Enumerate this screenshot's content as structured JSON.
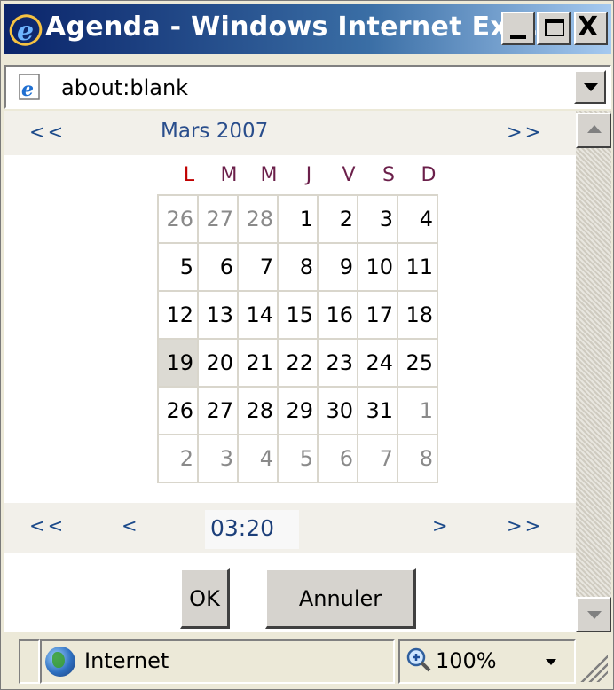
{
  "window": {
    "title": "Agenda - Windows Internet Ex...",
    "minimize_icon": "minimize-icon",
    "maximize_icon": "maximize-icon",
    "close_icon": "close-icon",
    "close_glyph": "X"
  },
  "address": {
    "url": "about:blank",
    "page_icon": "ie-page-icon"
  },
  "calendar": {
    "prev_month": "<<",
    "next_month": ">>",
    "month_label": "Mars 2007",
    "weekdays": [
      "L",
      "M",
      "M",
      "J",
      "V",
      "S",
      "D"
    ],
    "weeks": [
      [
        "26",
        "27",
        "28",
        "1",
        "2",
        "3",
        "4"
      ],
      [
        "5",
        "6",
        "7",
        "8",
        "9",
        "10",
        "11"
      ],
      [
        "12",
        "13",
        "14",
        "15",
        "16",
        "17",
        "18"
      ],
      [
        "19",
        "20",
        "21",
        "22",
        "23",
        "24",
        "25"
      ],
      [
        "26",
        "27",
        "28",
        "29",
        "30",
        "31",
        "1"
      ],
      [
        "2",
        "3",
        "4",
        "5",
        "6",
        "7",
        "8"
      ]
    ],
    "selected_day": "19"
  },
  "time": {
    "fast_back": "<<",
    "back": "<",
    "value": "03:20",
    "forward": ">",
    "fast_forward": ">>"
  },
  "buttons": {
    "ok": "OK",
    "cancel": "Annuler"
  },
  "status": {
    "zone": "Internet",
    "zoom": "100%"
  },
  "colors": {
    "nav_link": "#1c4a8a",
    "title_bar_start": "#0a246a",
    "title_bar_end": "#a6caf0",
    "selected_day_bg": "#dcdad3"
  }
}
